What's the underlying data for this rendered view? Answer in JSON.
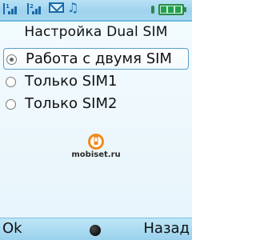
{
  "status": {
    "sim1_label": "1",
    "sim2_label": "2",
    "battery_level_fraction": 1.0,
    "icons": [
      "signal-sim1-icon",
      "signal-sim2-icon",
      "message-envelope-icon",
      "music-note-icon",
      "battery-icon"
    ]
  },
  "title": "Настройка Dual SIM",
  "options": [
    {
      "label": "Работа с двумя SIM",
      "selected": true
    },
    {
      "label": "Только SIM1",
      "selected": false
    },
    {
      "label": "Только SIM2",
      "selected": false
    }
  ],
  "watermark": {
    "text": "mobiset.ru"
  },
  "softkeys": {
    "left": "Ok",
    "right": "Назад"
  },
  "colors": {
    "statusbar": "#9fd3ee",
    "softbar": "#98d0ec",
    "highlight_border": "#5a9fc9"
  }
}
